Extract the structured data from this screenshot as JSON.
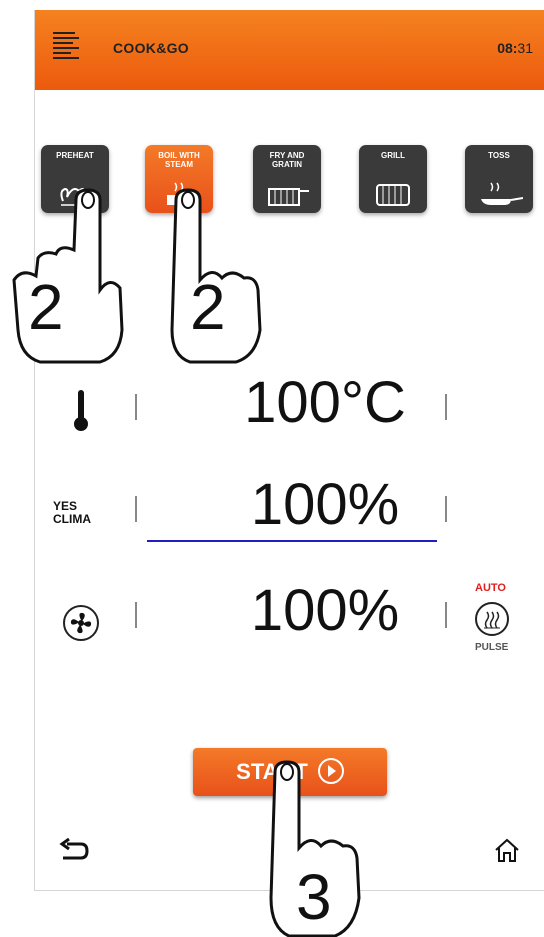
{
  "header": {
    "title": "COOK&GO",
    "time_hours": "08:",
    "time_minutes": "31"
  },
  "modes": [
    {
      "label": "PREHEAT",
      "icon": "preheat-icon",
      "active": false
    },
    {
      "label": "BOIL WITH STEAM",
      "icon": "boil-steam-icon",
      "active": true
    },
    {
      "label": "FRY AND GRATIN",
      "icon": "fry-basket-icon",
      "active": false
    },
    {
      "label": "GRILL",
      "icon": "grill-icon",
      "active": false
    },
    {
      "label": "TOSS",
      "icon": "pan-icon",
      "active": false
    }
  ],
  "settings": {
    "temperature": "100°C",
    "climate_label": "YES CLIMA",
    "climate": "100%",
    "fan": "100%",
    "auto_label": "AUTO",
    "pulse_label": "PULSE"
  },
  "start_button": {
    "label": "START"
  },
  "annotations": {
    "step_preheat": "2",
    "step_boil": "2",
    "step_start": "3"
  },
  "colors": {
    "accent": "#ec5a0d",
    "tile_dark": "#3a3a3a",
    "underline": "#2020c0",
    "auto_red": "#e01e1e"
  }
}
